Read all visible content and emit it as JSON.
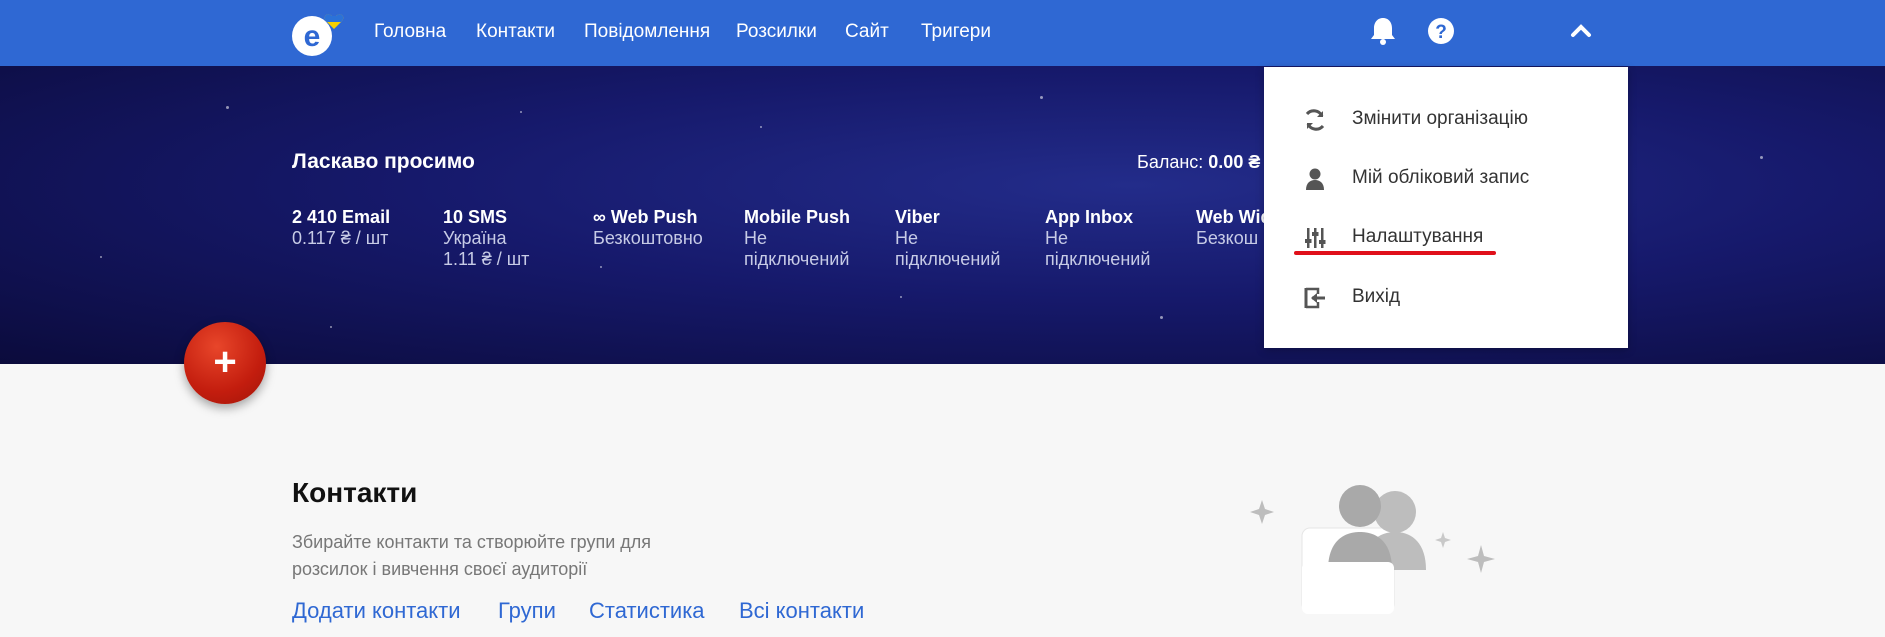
{
  "nav": {
    "items": [
      "Головна",
      "Контакти",
      "Повідомлення",
      "Розсилки",
      "Сайт",
      "Тригери"
    ]
  },
  "icons": {
    "logo": "logo-e-heart",
    "bell": "bell-icon",
    "help": "help-icon",
    "chevron": "chevron-up-icon"
  },
  "hero": {
    "welcome": "Ласкаво просимо",
    "balance_label": "Баланс:",
    "balance_value": "0.00 ₴",
    "stats": [
      {
        "title": "2 410   Email",
        "sub1": "0.117 ₴ / шт",
        "sub2": ""
      },
      {
        "title": "10 SMS",
        "sub1": "Україна",
        "sub2": "1.11 ₴ / шт"
      },
      {
        "title": "∞  Web Push",
        "sub1": "Безкоштовно",
        "sub2": ""
      },
      {
        "title": "Mobile Push",
        "sub1": "Не",
        "sub2": "підключений"
      },
      {
        "title": "Viber",
        "sub1": "Не",
        "sub2": "підключений"
      },
      {
        "title": "App Inbox",
        "sub1": "Не",
        "sub2": "підключений"
      },
      {
        "title": "Web Wid",
        "sub1": "Безкош",
        "sub2": ""
      }
    ]
  },
  "fab": {
    "label": "+"
  },
  "contacts": {
    "title": "Контакти",
    "description": "Збирайте контакти та створюйте групи для розсилок і вивчення своєї аудиторії",
    "links": [
      "Додати контакти",
      "Групи",
      "Статистика",
      "Всі контакти"
    ]
  },
  "dropdown": {
    "items": [
      {
        "label": "Змінити організацію",
        "icon": "refresh-icon"
      },
      {
        "label": "Мій обліковий запис",
        "icon": "user-icon"
      },
      {
        "label": "Налаштування",
        "icon": "sliders-icon"
      },
      {
        "label": "Вихід",
        "icon": "logout-icon"
      }
    ]
  },
  "colors": {
    "brand": "#2f68d3",
    "accent_red": "#e0101a",
    "hero_dark": "#16196b"
  }
}
